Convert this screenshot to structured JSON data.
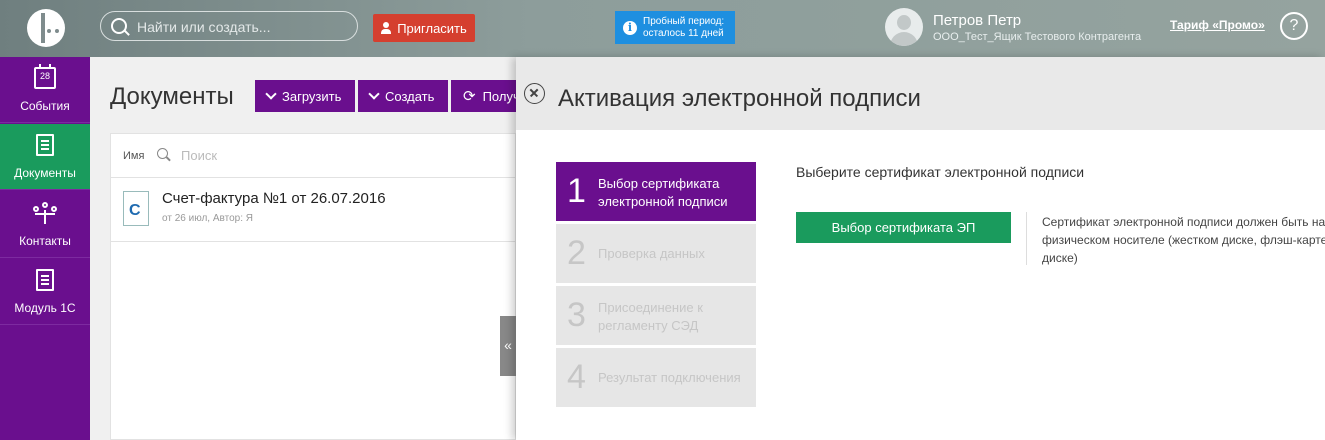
{
  "topbar": {
    "search_placeholder": "Найти или создать...",
    "invite_label": "Пригласить",
    "trial_line1": "Пробный период:",
    "trial_line2": "осталось 11 дней",
    "user_name": "Петров Петр",
    "user_org": "ООО_Тест_Ящик Тестового Контрагента",
    "tariff_label": "Тариф «Промо»",
    "help_label": "?",
    "colors": {
      "invite": "#d53f2f",
      "trial": "#1e8fe0"
    }
  },
  "sidebar": {
    "items": [
      {
        "label": "События",
        "icon": "calendar-icon",
        "day": "28",
        "active": false
      },
      {
        "label": "Документы",
        "icon": "documents-icon",
        "active": true
      },
      {
        "label": "Контакты",
        "icon": "contacts-icon",
        "active": false
      },
      {
        "label": "Модуль 1С",
        "icon": "module-icon",
        "active": false
      }
    ],
    "colors": {
      "bg": "#6a0f8e",
      "active": "#1a9b5d"
    }
  },
  "documents": {
    "title": "Документы",
    "toolbar": {
      "upload_label": "Загрузить",
      "create_label": "Создать",
      "receive_label": "Получ"
    },
    "column_label": "Имя",
    "search_placeholder": "Поиск",
    "rows": [
      {
        "icon_letter": "C",
        "title": "Счет-фактура №1 от 26.07.2016",
        "subtitle": "от 26 июл, Автор: Я"
      }
    ],
    "collapse_label": "«"
  },
  "panel": {
    "title": "Активация электронной подписи",
    "steps": [
      {
        "num": "1",
        "label": "Выбор сертификата электронной подписи",
        "active": true
      },
      {
        "num": "2",
        "label": "Проверка данных",
        "active": false
      },
      {
        "num": "3",
        "label": "Присоединение к регламенту СЭД",
        "active": false
      },
      {
        "num": "4",
        "label": "Результат подключения",
        "active": false
      }
    ],
    "instruction": "Выберите сертификат электронной подписи",
    "cert_button_label": "Выбор сертификата ЭП",
    "note": "Сертификат электронной подписи должен быть на физическом носителе (жестком диске, флэш-карте, диске)"
  }
}
